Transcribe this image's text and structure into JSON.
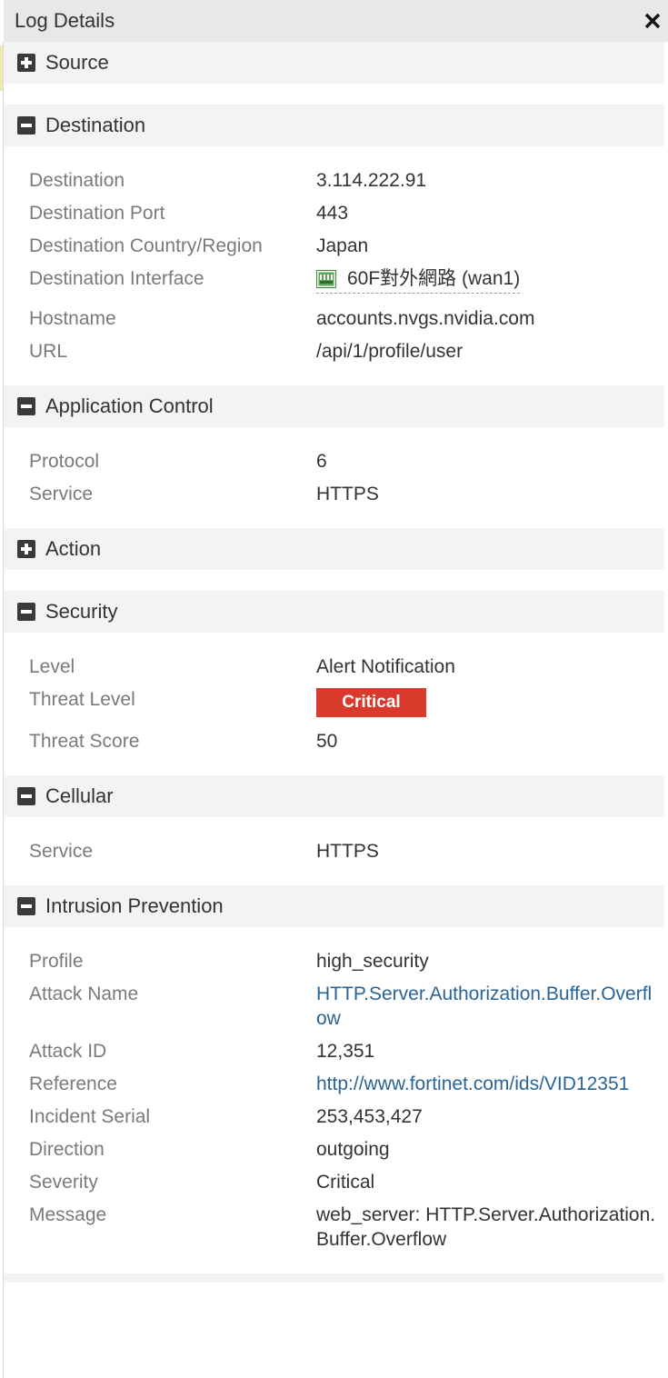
{
  "window": {
    "title": "Log Details",
    "close_symbol": "✕"
  },
  "sections": {
    "source": {
      "label": "Source",
      "expanded": false
    },
    "destination": {
      "label": "Destination",
      "expanded": true,
      "rows": {
        "destination": {
          "key": "Destination",
          "value": "3.114.222.91"
        },
        "port": {
          "key": "Destination Port",
          "value": "443"
        },
        "country": {
          "key": "Destination Country/Region",
          "value": "Japan"
        },
        "interface": {
          "key": "Destination Interface",
          "value": "60F對外網路 (wan1)",
          "icon": "network-port-icon"
        },
        "hostname": {
          "key": "Hostname",
          "value": "accounts.nvgs.nvidia.com"
        },
        "url": {
          "key": "URL",
          "value": "/api/1/profile/user"
        }
      }
    },
    "app_control": {
      "label": "Application Control",
      "expanded": true,
      "rows": {
        "protocol": {
          "key": "Protocol",
          "value": "6"
        },
        "service": {
          "key": "Service",
          "value": "HTTPS"
        }
      }
    },
    "action": {
      "label": "Action",
      "expanded": false
    },
    "security": {
      "label": "Security",
      "expanded": true,
      "rows": {
        "level": {
          "key": "Level",
          "value": "Alert Notification"
        },
        "threat_level": {
          "key": "Threat Level",
          "value": "Critical",
          "badge_color": "#d93a2b"
        },
        "threat_score": {
          "key": "Threat Score",
          "value": "50"
        }
      }
    },
    "cellular": {
      "label": "Cellular",
      "expanded": true,
      "rows": {
        "service": {
          "key": "Service",
          "value": "HTTPS"
        }
      }
    },
    "ips": {
      "label": "Intrusion Prevention",
      "expanded": true,
      "rows": {
        "profile": {
          "key": "Profile",
          "value": "high_security"
        },
        "attack_name": {
          "key": "Attack Name",
          "value": "HTTP.Server.Authorization.Buffer.Overflow"
        },
        "attack_id": {
          "key": "Attack ID",
          "value": "12,351"
        },
        "reference": {
          "key": "Reference",
          "value": "http://www.fortinet.com/ids/VID12351"
        },
        "incident_serial": {
          "key": "Incident Serial",
          "value": "253,453,427"
        },
        "direction": {
          "key": "Direction",
          "value": "outgoing"
        },
        "severity": {
          "key": "Severity",
          "value": "Critical"
        },
        "message": {
          "key": "Message",
          "value": "web_server: HTTP.Server.Authorization.Buffer.Overflow"
        }
      }
    }
  },
  "colors": {
    "header_bg": "#e8e8e8",
    "section_bg": "#f3f3f3",
    "key_text": "#7a7a7a",
    "link": "#2a6496",
    "critical": "#d93a2b"
  }
}
